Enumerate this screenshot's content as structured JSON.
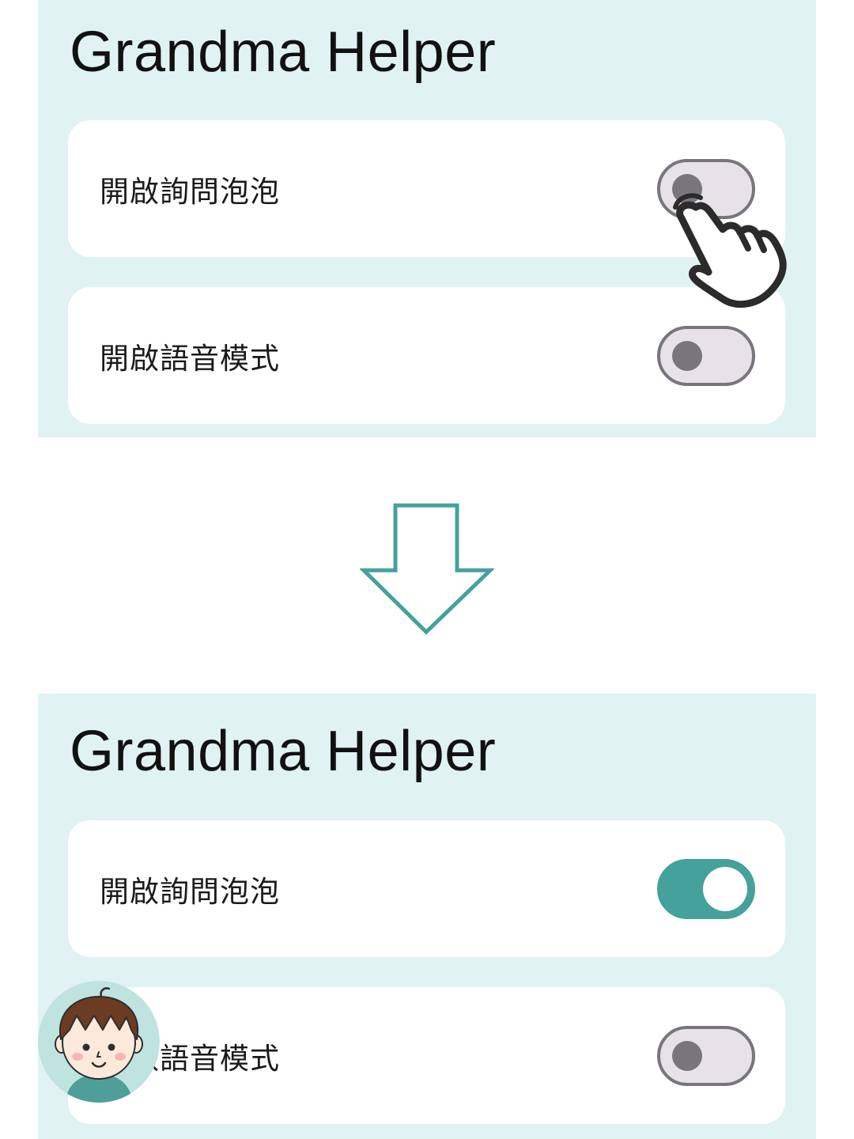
{
  "before": {
    "app_title": "Grandma Helper",
    "settings": [
      {
        "label": "開啟詢問泡泡",
        "state": "off"
      },
      {
        "label": "開啟語音模式",
        "state": "off"
      }
    ]
  },
  "after": {
    "app_title": "Grandma Helper",
    "settings": [
      {
        "label": "開啟詢問泡泡",
        "state": "on"
      },
      {
        "label": "開啟語音模式",
        "state": "off"
      }
    ]
  },
  "icons": {
    "tap_gesture": "hand-pointer-icon",
    "transition": "down-arrow-icon",
    "assistant": "boy-avatar-icon"
  },
  "colors": {
    "panel_background": "#e1f2f2",
    "card_background": "#ffffff",
    "accent": "#45a19b",
    "toggle_off_track": "#e7e1e8",
    "toggle_off_outline": "#79757d",
    "title_text": "#111111"
  }
}
